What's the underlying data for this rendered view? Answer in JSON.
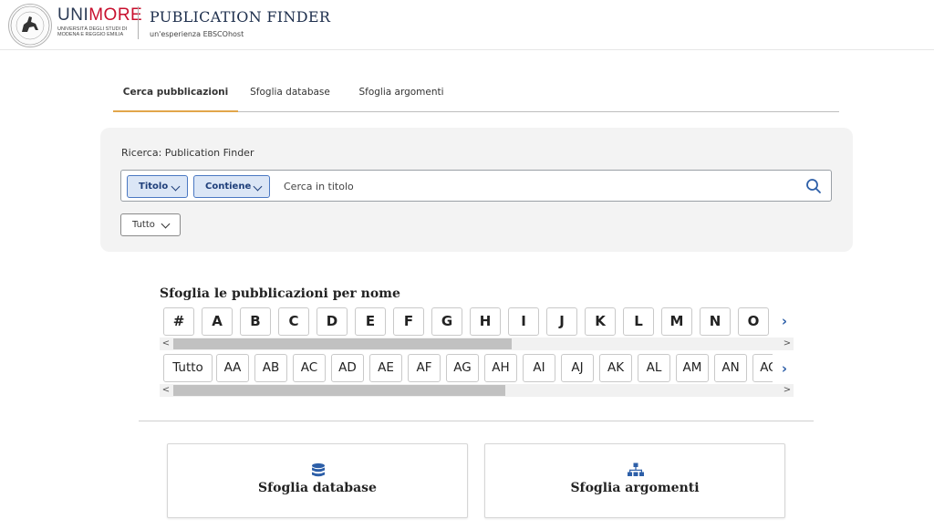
{
  "header": {
    "brand_part1": "UNI",
    "brand_part2": "MORE",
    "brand_sub": "Università degli Studi di Modena e Reggio Emilia",
    "app_title": "PUBLICATION FINDER",
    "app_subtitle": "un'esperienza EBSCOhost",
    "seal_icon": "university-seal-icon"
  },
  "tabs": [
    {
      "label": "Cerca pubblicazioni",
      "active": true
    },
    {
      "label": "Sfoglia database",
      "active": false
    },
    {
      "label": "Sfoglia argomenti",
      "active": false
    }
  ],
  "search": {
    "panel_label": "Ricerca: Publication Finder",
    "field_select": "Titolo",
    "operator_select": "Contiene",
    "placeholder": "Cerca in titolo",
    "value": "",
    "filter_select": "Tutto",
    "icon": "search-icon"
  },
  "browse": {
    "title": "Sfoglia le pubblicazioni per nome",
    "letters": [
      "#",
      "A",
      "B",
      "C",
      "D",
      "E",
      "F",
      "G",
      "H",
      "I",
      "J",
      "K",
      "L",
      "M",
      "N",
      "O"
    ],
    "pairs": [
      "Tutto",
      "AA",
      "AB",
      "AC",
      "AD",
      "AE",
      "AF",
      "AG",
      "AH",
      "AI",
      "AJ",
      "AK",
      "AL",
      "AM",
      "AN",
      "AO"
    ],
    "next_glyph": "›",
    "scroll_left": "<",
    "scroll_right": ">"
  },
  "cards": [
    {
      "label": "Sfoglia database",
      "icon": "database-icon"
    },
    {
      "label": "Sfoglia argomenti",
      "icon": "hierarchy-icon"
    }
  ],
  "colors": {
    "tab_active_underline": "#e2a64b",
    "pill_bg": "#dbe6f6",
    "pill_border": "#4a78c2",
    "icon_blue": "#2d5fa8",
    "brand_red": "#c8102e"
  }
}
